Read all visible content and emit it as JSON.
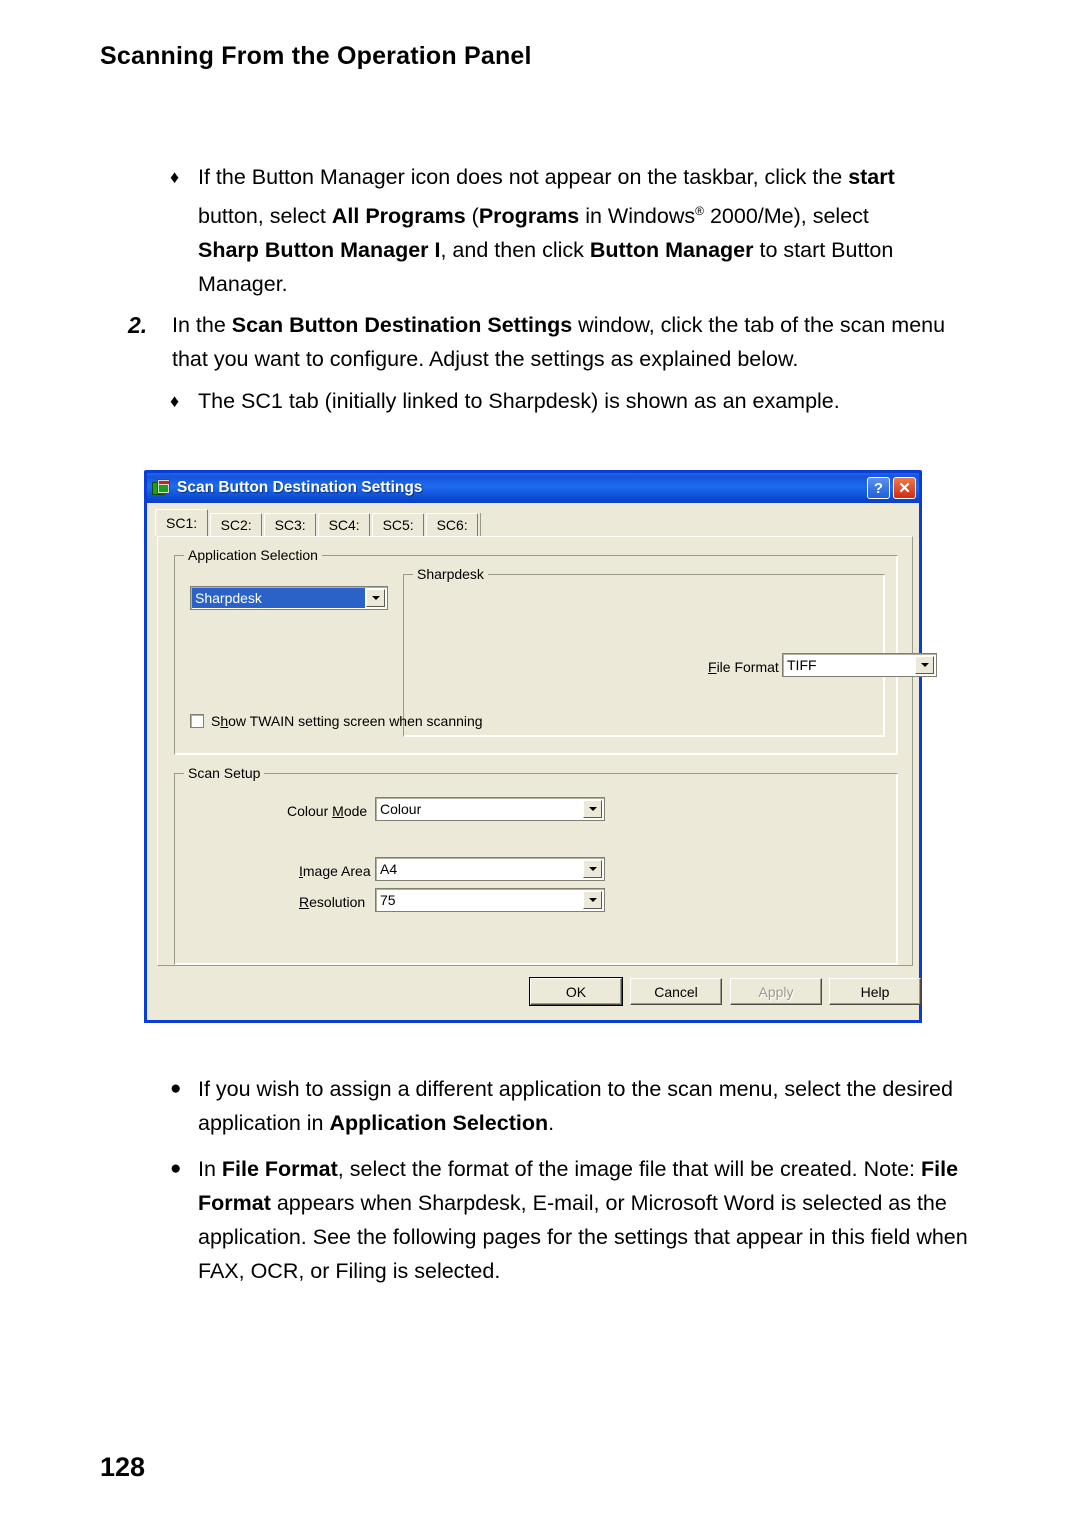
{
  "page": {
    "header": "Scanning From the Operation Panel",
    "number": "128"
  },
  "content": {
    "bullet1": {
      "marker": "♦",
      "line1_a": "If the Button Manager icon does not appear on the taskbar, click the ",
      "line1_b": "start",
      "line2_a": "button, select ",
      "line2_b": "All Programs",
      "line2_c": " (",
      "line2_d": "Programs",
      "line2_e": " in Windows",
      "line2_reg": "®",
      "line2_f": " 2000/Me), select",
      "line3_a": "Sharp Button Manager I",
      "line3_b": ", and then click ",
      "line3_c": "Button Manager",
      "line3_d": " to start Button",
      "line4": "Manager."
    },
    "step2": {
      "marker": "2.",
      "a": "In the ",
      "b": "Scan Button Destination Settings",
      "c": " window, click the tab of the scan menu that you want to configure. Adjust the settings as explained below."
    },
    "bullet2": {
      "marker": "♦",
      "text": "The SC1 tab (initially linked to Sharpdesk) is shown as an example."
    },
    "bullet3": {
      "marker": "●",
      "a": "If you wish to assign a different application to the scan menu, select the desired application in ",
      "b": "Application Selection",
      "c": "."
    },
    "bullet4": {
      "marker": "●",
      "a": "In ",
      "b": "File Format",
      "c": ", select the format of the image file that will be created.",
      "note_a": "Note: ",
      "note_b": "File Format",
      "note_c": " appears when Sharpdesk, E-mail, or Microsoft Word is selected as the application. See the following pages for the settings that appear in this field when FAX, OCR, or Filing is selected."
    }
  },
  "dialog": {
    "title": "Scan Button Destination Settings",
    "help_button": "?",
    "close_button": "✕",
    "tabs": [
      {
        "label": "SC1:",
        "active": true
      },
      {
        "label": "SC2:",
        "active": false
      },
      {
        "label": "SC3:",
        "active": false
      },
      {
        "label": "SC4:",
        "active": false
      },
      {
        "label": "SC5:",
        "active": false
      },
      {
        "label": "SC6:",
        "active": false
      }
    ],
    "application_selection": {
      "group_label": "Application Selection",
      "app_combo_value": "Sharpdesk",
      "inner_group_label": "Sharpdesk",
      "file_format_label_u": "F",
      "file_format_label_rest": "ile Format",
      "file_format_value": "TIFF"
    },
    "twain_checkbox": {
      "label_a": "S",
      "label_u": "h",
      "label_b": "ow TWAIN setting screen when scanning",
      "checked": false
    },
    "scan_setup": {
      "group_label": "Scan Setup",
      "colour_mode_label_a": "Colour ",
      "colour_mode_label_u": "M",
      "colour_mode_label_b": "ode",
      "colour_mode_value": "Colour",
      "image_area_label_u": "I",
      "image_area_label_rest": "mage Area",
      "image_area_value": "A4",
      "resolution_label_u": "R",
      "resolution_label_rest": "esolution",
      "resolution_value": "75"
    },
    "buttons": {
      "ok": "OK",
      "cancel": "Cancel",
      "apply": "Apply",
      "help": "Help"
    },
    "colors": {
      "titlebar_blue": "#0a46cf",
      "dialog_face": "#ece9d8",
      "selection_blue": "#2a62c8",
      "close_red": "#cf2b13"
    }
  }
}
